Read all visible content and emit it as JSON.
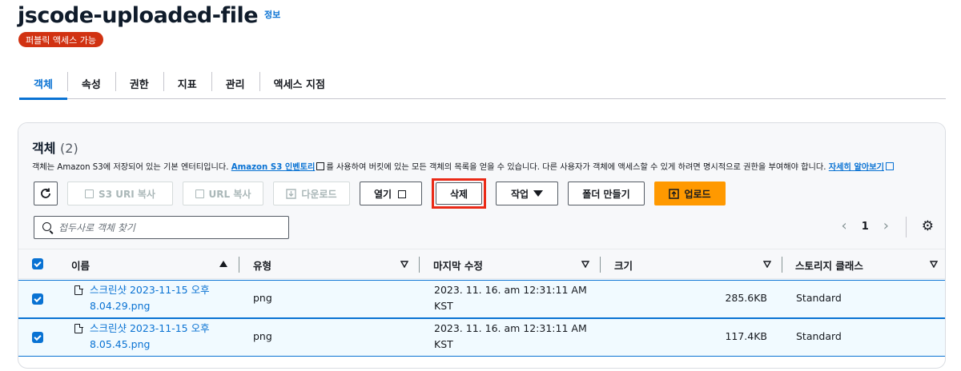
{
  "header": {
    "title": "jscode-uploaded-file",
    "info_link": "정보",
    "badge": "퍼블릭 액세스 가능"
  },
  "tabs": [
    {
      "label": "객체",
      "active": true
    },
    {
      "label": "속성"
    },
    {
      "label": "권한"
    },
    {
      "label": "지표"
    },
    {
      "label": "관리"
    },
    {
      "label": "액세스 지점"
    }
  ],
  "objects": {
    "title": "객체",
    "count": "(2)",
    "description_pre": "객체는 Amazon S3에 저장되어 있는 기본 엔터티입니다.",
    "inventory_link": "Amazon S3 인벤토리",
    "description_mid": "를 사용하여 버킷에 있는 모든 객체의 목록을 얻을 수 있습니다. 다른 사용자가 객체에 액세스할 수 있게 하려면 명시적으로 권한을 부여해야 합니다.",
    "learn_more_link": "자세히 알아보기"
  },
  "toolbar": {
    "copy_s3_uri": "S3 URI 복사",
    "copy_url": "URL 복사",
    "download": "다운로드",
    "open": "열기",
    "delete": "삭제",
    "actions": "작업",
    "create_folder": "폴더 만들기",
    "upload": "업로드"
  },
  "search": {
    "placeholder": "접두사로 객체 찾기"
  },
  "pagination": {
    "current_page": "1"
  },
  "table": {
    "columns": [
      "이름",
      "유형",
      "마지막 수정",
      "크기",
      "스토리지 클래스"
    ],
    "rows": [
      {
        "name_line1": "스크린샷 2023-11-15 오후",
        "name_line2": "8.04.29.png",
        "type": "png",
        "modified_line1": "2023. 11. 16. am 12:31:11 AM",
        "modified_line2": "KST",
        "size": "285.6KB",
        "storage_class": "Standard"
      },
      {
        "name_line1": "스크린샷 2023-11-15 오후",
        "name_line2": "8.05.45.png",
        "type": "png",
        "modified_line1": "2023. 11. 16. am 12:31:11 AM",
        "modified_line2": "KST",
        "size": "117.4KB",
        "storage_class": "Standard"
      }
    ]
  },
  "colors": {
    "accent": "#0972d3",
    "badge": "#d13212",
    "upload": "#ff9900",
    "highlight": "#ea2a17"
  }
}
